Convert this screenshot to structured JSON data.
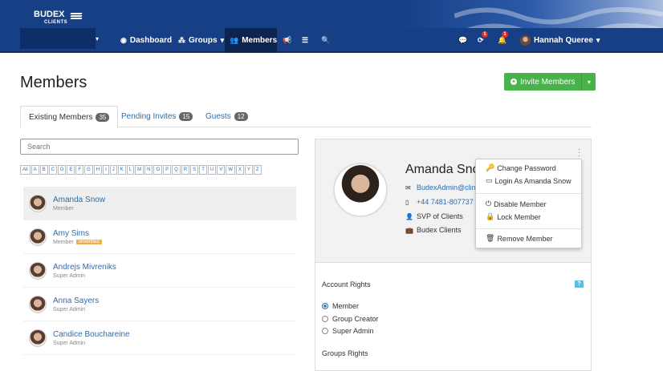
{
  "brand": {
    "name": "BUDEX",
    "sub": "CLIENTS"
  },
  "nav": {
    "dashboard": "Dashboard",
    "groups": "Groups",
    "members": "Members",
    "notif_badge_1": "1",
    "notif_badge_2": "1",
    "user_name": "Hannah Queree"
  },
  "page": {
    "title": "Members",
    "invite_label": "Invite Members"
  },
  "tabs": [
    {
      "label": "Existing Members",
      "count": "35"
    },
    {
      "label": "Pending Invites",
      "count": "15"
    },
    {
      "label": "Guests",
      "count": "12"
    }
  ],
  "search": {
    "placeholder": "Search"
  },
  "alphabet": [
    "All",
    "A",
    "B",
    "C",
    "D",
    "E",
    "F",
    "G",
    "H",
    "I",
    "J",
    "K",
    "L",
    "M",
    "N",
    "O",
    "P",
    "Q",
    "R",
    "S",
    "T",
    "U",
    "V",
    "W",
    "X",
    "Y",
    "Z"
  ],
  "members": [
    {
      "name": "Amanda Snow",
      "role": "Member",
      "badge": ""
    },
    {
      "name": "Amy Sims",
      "role": "Member",
      "badge": "unverified"
    },
    {
      "name": "Andrejs Mivreniks",
      "role": "Super Admin",
      "badge": ""
    },
    {
      "name": "Anna Sayers",
      "role": "Super Admin",
      "badge": ""
    },
    {
      "name": "Candice Bouchareine",
      "role": "Super Admin",
      "badge": ""
    }
  ],
  "detail": {
    "name": "Amanda Snow",
    "email": "BudexAdmin@clin",
    "phone": "+44 7481-807737",
    "title": "SVP of Clients",
    "company": "Budex Clients",
    "account_rights_title": "Account Rights",
    "help": "?",
    "rights": [
      "Member",
      "Group Creator",
      "Super Admin"
    ],
    "selected_right": "Member",
    "groups_rights_title": "Groups Rights"
  },
  "menu": {
    "change_password": "Change Password",
    "login_as": "Login As Amanda Snow",
    "disable": "Disable Member",
    "lock": "Lock Member",
    "remove": "Remove Member"
  },
  "colors": {
    "nav_blue": "#163f86",
    "accent_green": "#49b34b",
    "link_blue": "#2a6db0",
    "badge_orange": "#f0ad4e"
  }
}
